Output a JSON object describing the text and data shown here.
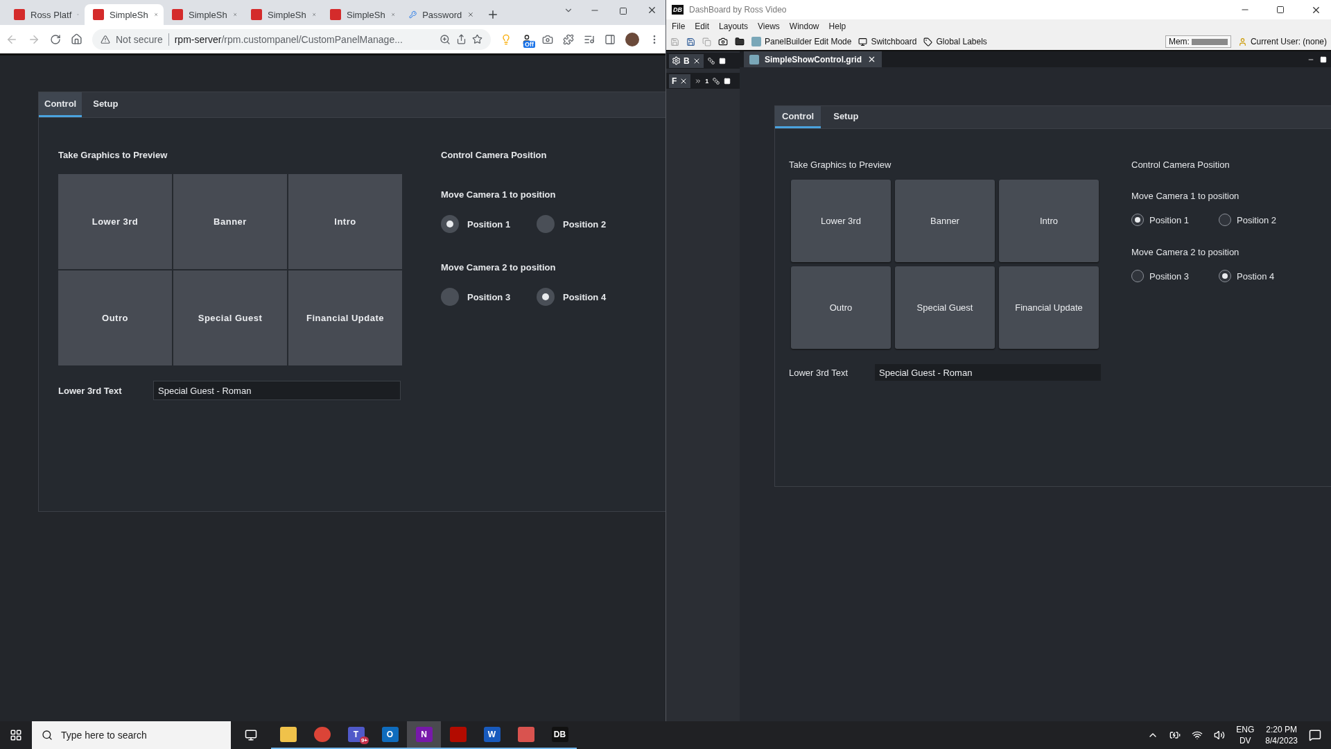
{
  "browser": {
    "tabs": [
      {
        "title": "Ross Platf",
        "kind": "app",
        "selected": false
      },
      {
        "title": "SimpleSh",
        "kind": "app",
        "selected": true
      },
      {
        "title": "SimpleSh",
        "kind": "app",
        "selected": false
      },
      {
        "title": "SimpleSh",
        "kind": "app",
        "selected": false
      },
      {
        "title": "SimpleSh",
        "kind": "app",
        "selected": false
      },
      {
        "title": "Password",
        "kind": "key",
        "selected": false
      }
    ],
    "security": "Not secure",
    "host": "rpm-server",
    "path": "/rpm.custompanel/CustomPanelManage...",
    "extension_badge": "Off",
    "panel": {
      "tabs": [
        {
          "label": "Control",
          "selected": true
        },
        {
          "label": "Setup",
          "selected": false
        }
      ],
      "graphics_heading": "Take Graphics to Preview",
      "graphics_buttons": [
        "Lower 3rd",
        "Banner",
        "Intro",
        "Outro",
        "Special Guest",
        "Financial Update"
      ],
      "text_field": {
        "label": "Lower 3rd Text",
        "value": "Special Guest - Roman"
      },
      "camera_heading": "Control Camera Position",
      "cameras": [
        {
          "label": "Move Camera 1 to position",
          "options": [
            {
              "label": "Position 1",
              "selected": true
            },
            {
              "label": "Position 2",
              "selected": false
            }
          ]
        },
        {
          "label": "Move Camera 2 to position",
          "options": [
            {
              "label": "Position 3",
              "selected": false
            },
            {
              "label": "Position 4",
              "selected": true
            }
          ]
        }
      ]
    }
  },
  "dashboard": {
    "logo": "DB",
    "title": "DashBoard by Ross Video",
    "menu": [
      "File",
      "Edit",
      "Layouts",
      "Views",
      "Window",
      "Help"
    ],
    "toolbar": [
      {
        "label": "PanelBuilder Edit Mode",
        "kind": "panelbuilder"
      },
      {
        "label": "Switchboard",
        "kind": "switchboard"
      },
      {
        "label": "Global Labels",
        "kind": "labels"
      }
    ],
    "mem_label": "Mem:",
    "user": "Current User: (none)",
    "side_tabs": [
      {
        "label": "B"
      },
      {
        "label": "F"
      }
    ],
    "side_overflow": "1",
    "document_tab": "SimpleShowControl.grid",
    "panel": {
      "tabs": [
        {
          "label": "Control",
          "selected": true
        },
        {
          "label": "Setup",
          "selected": false
        }
      ],
      "graphics_heading": "Take Graphics to Preview",
      "graphics_buttons": [
        "Lower 3rd",
        "Banner",
        "Intro",
        "Outro",
        "Special Guest",
        "Financial Update"
      ],
      "text_field": {
        "label": "Lower 3rd Text",
        "value": "Special Guest - Roman"
      },
      "camera_heading": "Control Camera Position",
      "cameras": [
        {
          "label": "Move Camera 1 to position",
          "options": [
            {
              "label": "Position 1",
              "selected": true
            },
            {
              "label": "Position 2",
              "selected": false
            }
          ]
        },
        {
          "label": "Move Camera 2 to position",
          "options": [
            {
              "label": "Position 3",
              "selected": false
            },
            {
              "label": "Postion 4",
              "selected": true
            }
          ]
        }
      ]
    }
  },
  "taskbar": {
    "search_placeholder": "Type here to search",
    "apps": [
      {
        "kind": "files",
        "selected": false
      },
      {
        "kind": "chrome",
        "selected": false
      },
      {
        "kind": "teams",
        "letter": "T",
        "badge": "9+",
        "selected": false
      },
      {
        "kind": "outlook",
        "letter": "O",
        "selected": false
      },
      {
        "kind": "onenote",
        "letter": "N",
        "selected": true
      },
      {
        "kind": "acrobat",
        "selected": false
      },
      {
        "kind": "word",
        "letter": "W",
        "selected": false
      },
      {
        "kind": "panelbuilder",
        "selected": false
      },
      {
        "kind": "dashboard",
        "letter": "DB",
        "selected": false
      }
    ],
    "language": "ENG",
    "layout": "DV",
    "time": "2:20 PM",
    "date": "8/4/2023"
  }
}
